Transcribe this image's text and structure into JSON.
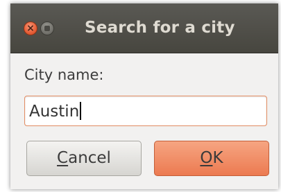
{
  "window": {
    "title": "Search for a city",
    "close_icon": "close-icon",
    "minimize_icon": "minimize-icon"
  },
  "form": {
    "label": "City name:",
    "city_value": "Austin"
  },
  "buttons": {
    "cancel_mnemonic": "C",
    "cancel_rest": "ancel",
    "ok_mnemonic": "O",
    "ok_rest": "K"
  },
  "colors": {
    "accent": "#ec7a51",
    "titlebar": "#4f4e48",
    "close_button": "#e8623b"
  }
}
